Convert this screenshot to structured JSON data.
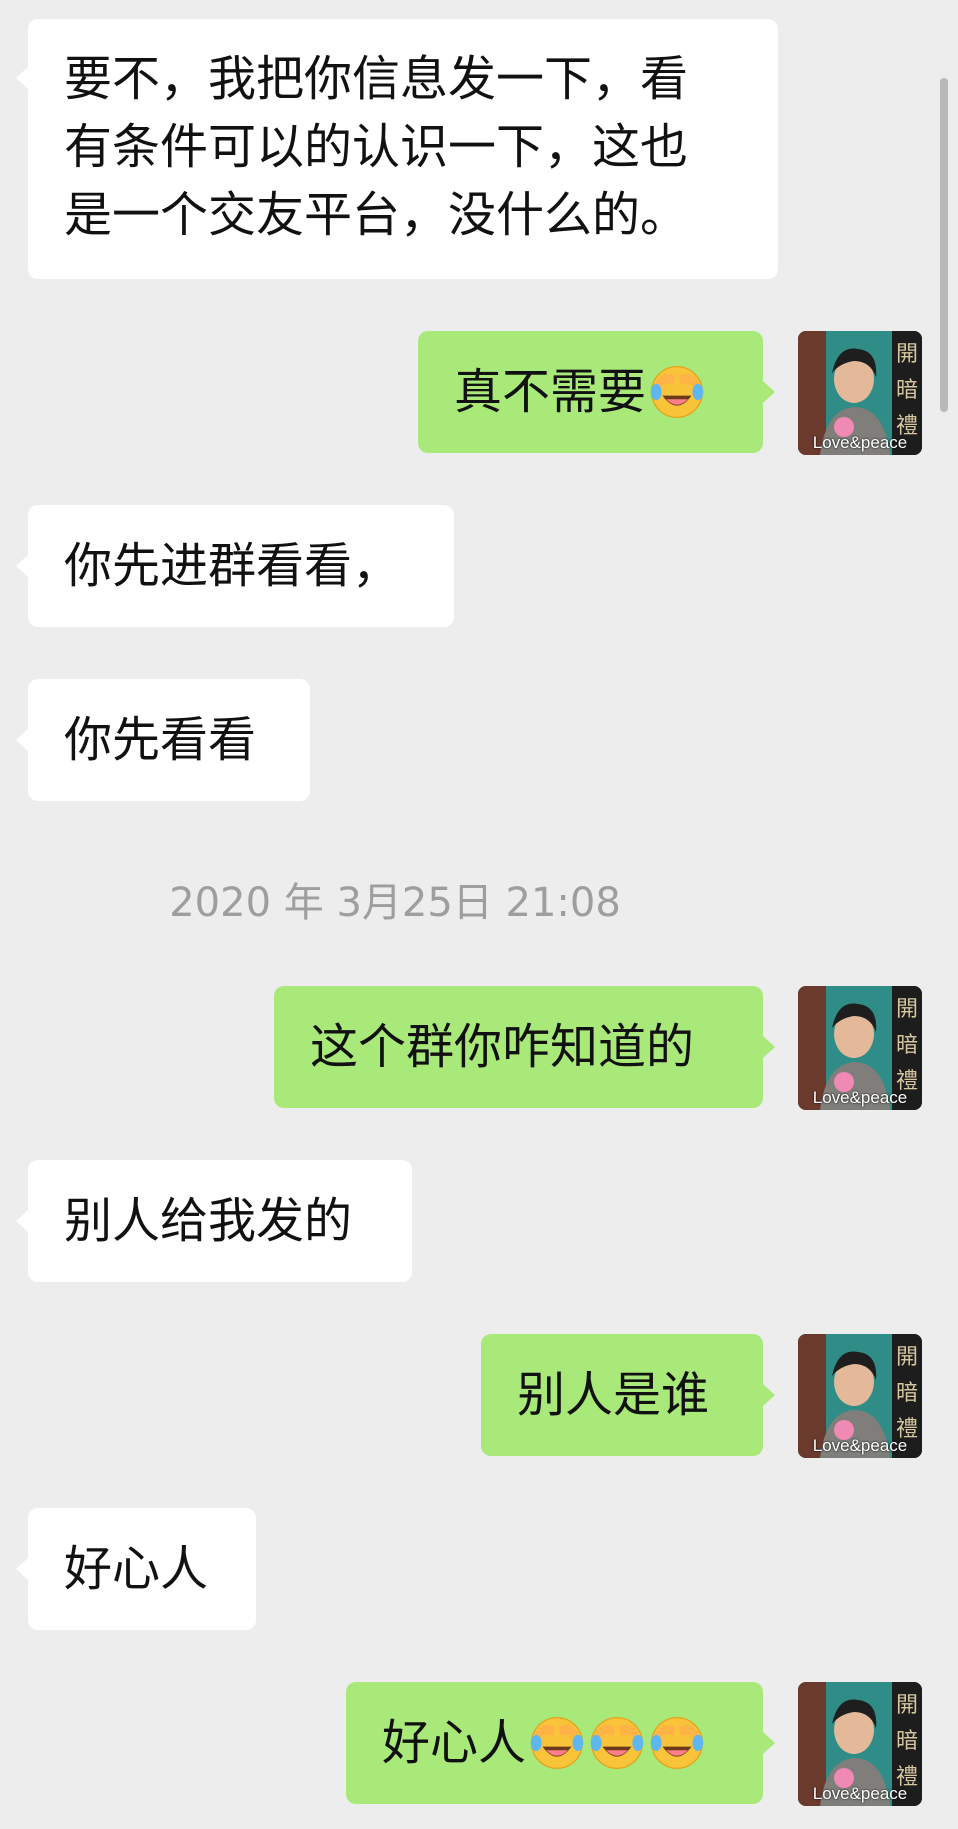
{
  "messages": [
    {
      "side": "received",
      "text": "要不，我把你信息发一下，看\n有条件可以的认识一下，这也\n是一个交友平台，没什么的。"
    },
    {
      "side": "sent",
      "text": "真不需要",
      "emoji_count": 1
    },
    {
      "side": "received",
      "text": "你先进群看看，"
    },
    {
      "side": "received",
      "text": "你先看看"
    },
    {
      "side": "timestamp",
      "text": "2020 年 3月25日 21:08"
    },
    {
      "side": "sent",
      "text": "这个群你咋知道的"
    },
    {
      "side": "received",
      "text": "别人给我发的"
    },
    {
      "side": "sent",
      "text": "别人是谁"
    },
    {
      "side": "received",
      "text": "好心人"
    },
    {
      "side": "sent",
      "text": "好心人",
      "emoji_count": 3
    }
  ],
  "avatar": {
    "caption": "Love&peace",
    "sign_text": "開暗禮"
  },
  "emoji": {
    "name": "face-with-tears-of-joy-icon"
  },
  "colors": {
    "background": "#ededed",
    "sent_bubble": "#a9e97a",
    "received_bubble": "#ffffff",
    "timestamp": "#9e9e9e"
  }
}
